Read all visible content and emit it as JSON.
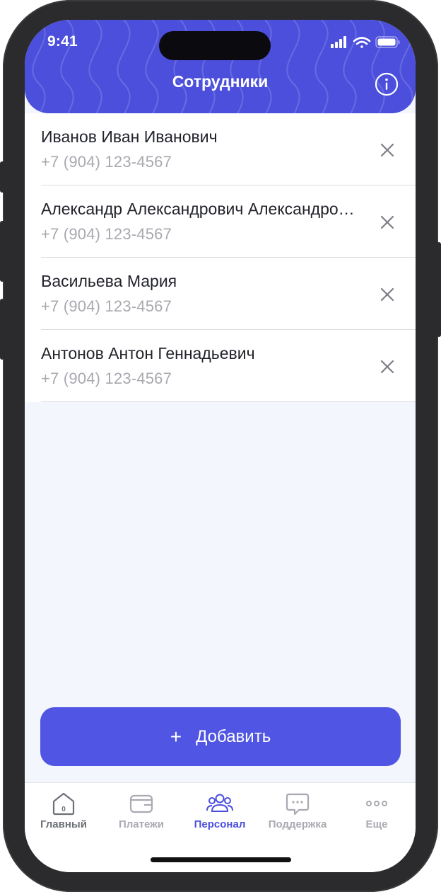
{
  "status_bar": {
    "time": "9:41"
  },
  "header": {
    "title": "Сотрудники",
    "info_icon": "info-circle-icon"
  },
  "employees": [
    {
      "name": "Иванов Иван Иванович",
      "phone": "+7 (904) 123-4567"
    },
    {
      "name": "Александр Александрович Александрович",
      "phone": "+7 (904) 123-4567"
    },
    {
      "name": "Васильева Мария",
      "phone": "+7 (904) 123-4567"
    },
    {
      "name": "Антонов Антон Геннадьевич",
      "phone": "+7 (904) 123-4567"
    }
  ],
  "add_button": {
    "icon": "+",
    "label": "Добавить"
  },
  "tabbar": {
    "items": [
      {
        "label": "Главный",
        "icon": "home-icon"
      },
      {
        "label": "Платежи",
        "icon": "wallet-icon"
      },
      {
        "label": "Персонал",
        "icon": "people-icon",
        "active": true
      },
      {
        "label": "Поддержка",
        "icon": "chat-icon"
      },
      {
        "label": "Еще",
        "icon": "more-icon"
      }
    ]
  },
  "colors": {
    "accent": "#4b4fdc",
    "button": "#5055e3",
    "background": "#f4f6fd",
    "text_primary": "#22232b",
    "text_secondary": "#a8a9b0"
  }
}
